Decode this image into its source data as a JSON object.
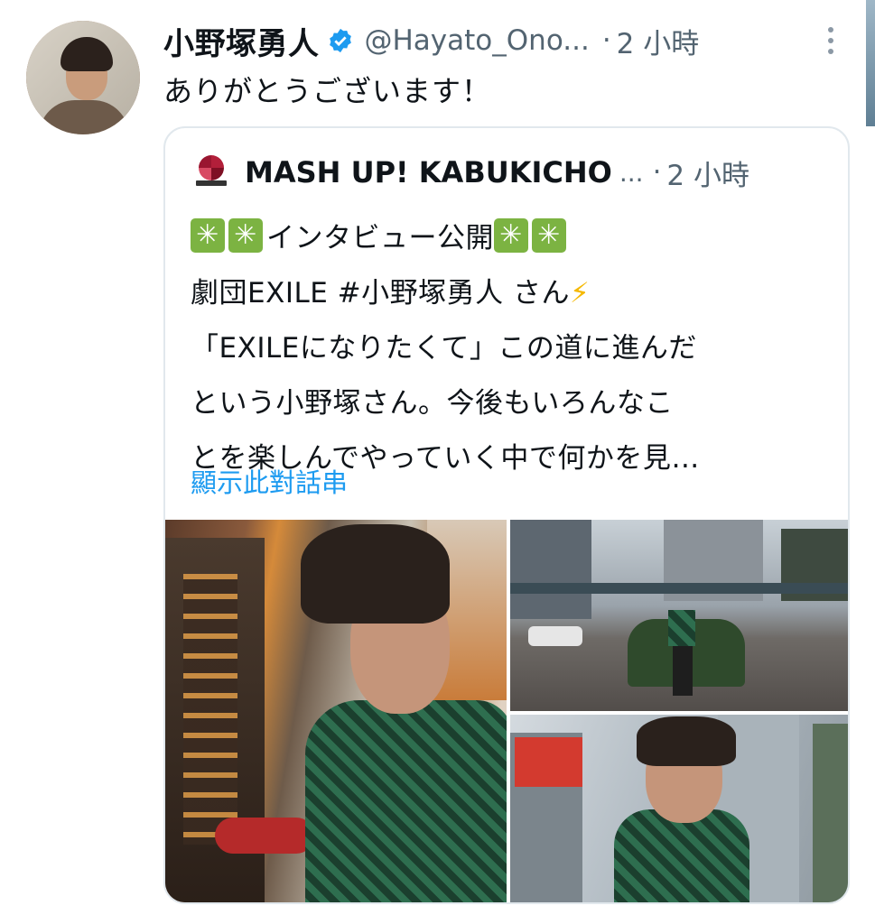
{
  "tweet": {
    "author_name": "小野塚勇人",
    "handle": "@Hayato_Ono...",
    "separator": "·",
    "time": "2 小時",
    "text": "ありがとうございます！",
    "verified_color": "#1d9bf0"
  },
  "quoted_tweet": {
    "account_name": "MASH UP! KABUKICHO",
    "name_ellipsis": "...",
    "separator": "·",
    "time": "2 小時",
    "line1_text": "インタビュー公開",
    "line2_text": "劇団EXILE #小野塚勇人 さん",
    "line2_emoji": "⚡",
    "line3_text": "「EXILEになりたくて」この道に進んだ",
    "line4_text": "という小野塚さん。今後もいろんなこ",
    "line5_text": "とを楽しんでやっていく中で何かを見…",
    "show_thread": "顯示此對話串",
    "link_color": "#1d9bf0"
  },
  "media": {
    "count": 3
  }
}
